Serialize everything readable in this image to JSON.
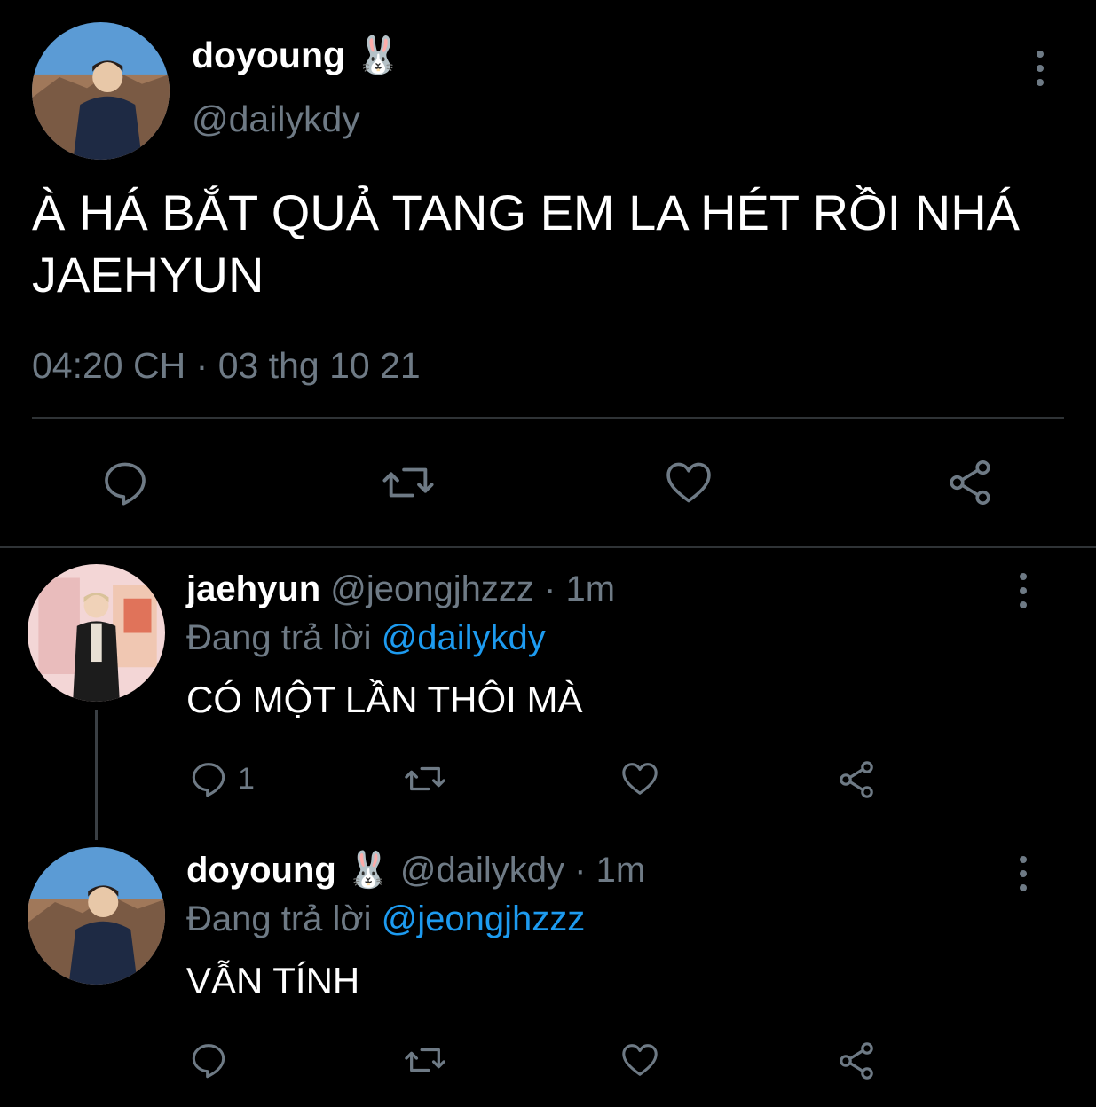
{
  "main_tweet": {
    "display_name": "doyoung",
    "emoji": "🐰",
    "handle": "@dailykdy",
    "text_line1": "À HÁ BẮT QUẢ TANG EM LA HÉT RỒI NHÁ",
    "text_line2": "JAEHYUN",
    "time": "04:20 CH",
    "separator": "·",
    "date": "03 thg 10 21"
  },
  "reply1": {
    "display_name": "jaehyun",
    "handle": "@jeongjhzzz",
    "dot": "·",
    "time": "1m",
    "replying_prefix": "Đang trả lời",
    "replying_to": "@dailykdy",
    "text": "CÓ MỘT LẦN THÔI MÀ",
    "reply_count": "1"
  },
  "reply2": {
    "display_name": "doyoung",
    "emoji": "🐰",
    "handle": "@dailykdy",
    "dot": "·",
    "time": "1m",
    "replying_prefix": "Đang trả lời",
    "replying_to": "@jeongjhzzz",
    "text": "VẪN TÍNH"
  },
  "colors": {
    "background": "#000000",
    "muted": "#6e7a85",
    "link": "#1d9bf0",
    "divider": "#2f3336"
  }
}
